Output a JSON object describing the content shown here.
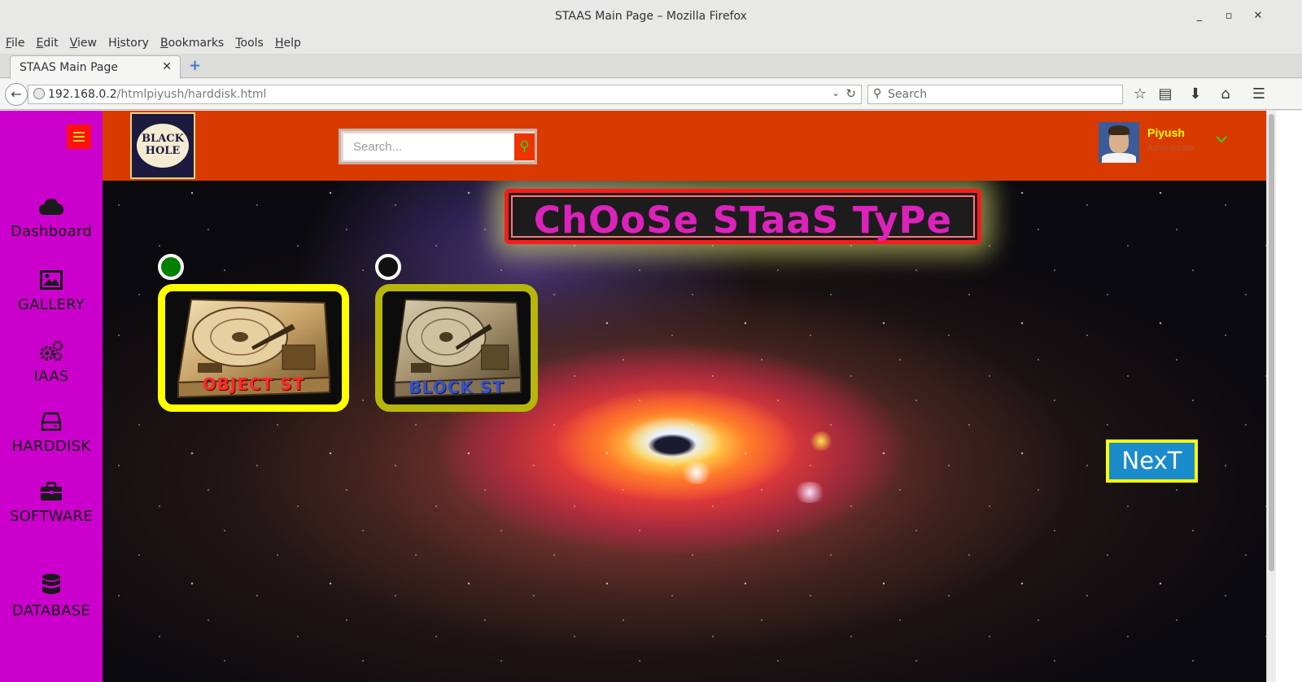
{
  "window": {
    "title": "STAAS Main Page – Mozilla Firefox",
    "controls": {
      "minimize": "_",
      "maximize": "▫",
      "close": "✕"
    }
  },
  "menu": {
    "items": [
      {
        "label": "File",
        "accesskey_index": 0
      },
      {
        "label": "Edit",
        "accesskey_index": 0
      },
      {
        "label": "View",
        "accesskey_index": 0
      },
      {
        "label": "History",
        "accesskey_index": 1
      },
      {
        "label": "Bookmarks",
        "accesskey_index": 0
      },
      {
        "label": "Tools",
        "accesskey_index": 0
      },
      {
        "label": "Help",
        "accesskey_index": 0
      }
    ]
  },
  "tab": {
    "label": "STAAS Main Page",
    "close": "✕"
  },
  "address": {
    "host": "192.168.0.2",
    "path": "/htmlpiyush/harddisk.html"
  },
  "browser_search": {
    "placeholder": "Search"
  },
  "site": {
    "logo_text": "BLACK HOLE",
    "search_placeholder": "Search...",
    "user": {
      "name": "Piyush",
      "role": "Administrator"
    },
    "nav": [
      {
        "label": "Dashboard",
        "icon": "cloud-icon"
      },
      {
        "label": "GALLERY",
        "icon": "image-icon"
      },
      {
        "label": "IAAS",
        "icon": "gears-icon"
      },
      {
        "label": "HARDDISK",
        "icon": "harddisk-icon"
      },
      {
        "label": "SOFTWARE",
        "icon": "briefcase-icon"
      },
      {
        "label": "DATABASE",
        "icon": "database-icon"
      }
    ]
  },
  "main": {
    "heading": "ChOoSe STaaS TyPe",
    "options": [
      {
        "label": "OBJECT ST",
        "selected": true
      },
      {
        "label": "BLOCK ST",
        "selected": false
      }
    ],
    "next_label": "NexT"
  },
  "colors": {
    "sidebar": "#cc00cc",
    "header": "#d93a00",
    "heading_text": "#dd22bb",
    "card_border": "#ffff00",
    "next_button": "#1a8ccc",
    "user_name": "#ffff00"
  }
}
